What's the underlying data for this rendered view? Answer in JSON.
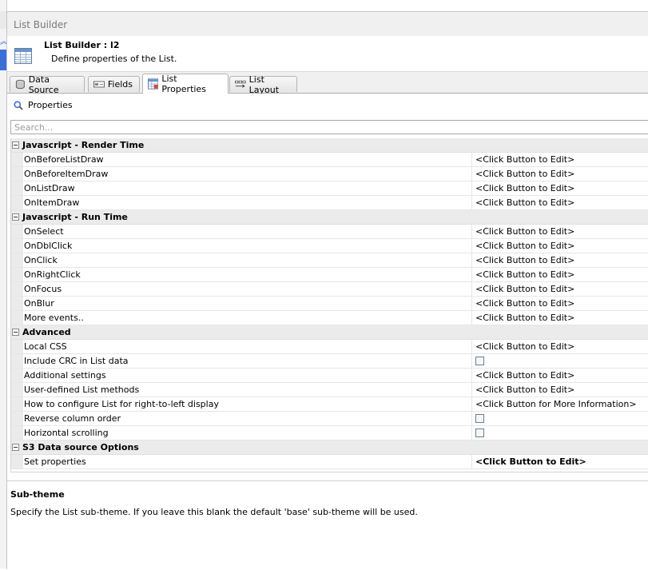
{
  "window": {
    "title": "List Builder"
  },
  "header": {
    "title": "List Builder : l2",
    "subtitle": "Define properties of the List."
  },
  "tabs": [
    {
      "label": "Data Source",
      "icon": "database-icon",
      "active": false
    },
    {
      "label": "Fields",
      "icon": "fields-icon",
      "active": false
    },
    {
      "label": "List Properties",
      "icon": "list-properties-icon",
      "active": true
    },
    {
      "label": "List Layout",
      "icon": "list-layout-icon",
      "active": false
    }
  ],
  "properties": {
    "heading": "Properties",
    "search_placeholder": "Search...",
    "categories": [
      {
        "name": "Javascript - Render Time",
        "items": [
          {
            "name": "OnBeforeListDraw",
            "value": "<Click Button to Edit>"
          },
          {
            "name": "OnBeforeItemDraw",
            "value": "<Click Button to Edit>"
          },
          {
            "name": "OnListDraw",
            "value": "<Click Button to Edit>"
          },
          {
            "name": "OnItemDraw",
            "value": "<Click Button to Edit>"
          }
        ]
      },
      {
        "name": "Javascript - Run Time",
        "items": [
          {
            "name": "OnSelect",
            "value": "<Click Button to Edit>"
          },
          {
            "name": "OnDblClick",
            "value": "<Click Button to Edit>"
          },
          {
            "name": "OnClick",
            "value": "<Click Button to Edit>"
          },
          {
            "name": "OnRightClick",
            "value": "<Click Button to Edit>"
          },
          {
            "name": "OnFocus",
            "value": "<Click Button to Edit>"
          },
          {
            "name": "OnBlur",
            "value": "<Click Button to Edit>"
          },
          {
            "name": "More events..",
            "value": "<Click Button to Edit>"
          }
        ]
      },
      {
        "name": "Advanced",
        "items": [
          {
            "name": "Local CSS",
            "value": "<Click Button to Edit>"
          },
          {
            "name": "Include CRC in List data",
            "value": "",
            "checkbox": true,
            "checked": false
          },
          {
            "name": "Additional settings",
            "value": "<Click Button to Edit>"
          },
          {
            "name": "User-defined List methods",
            "value": "<Click Button to Edit>"
          },
          {
            "name": "How to configure List for right-to-left display",
            "value": "<Click Button for More Information>"
          },
          {
            "name": "Reverse column order",
            "value": "",
            "checkbox": true,
            "checked": false
          },
          {
            "name": "Horizontal scrolling",
            "value": "",
            "checkbox": true,
            "checked": false
          }
        ]
      },
      {
        "name": "S3 Data source Options",
        "items": [
          {
            "name": "Set properties",
            "value": "<Click Button to Edit>",
            "bold": true
          }
        ]
      }
    ]
  },
  "description": {
    "title": "Sub-theme",
    "text": "Specify the List sub-theme. If you leave this blank the default 'base' sub-theme will be used."
  },
  "colors": {
    "accent": "#3b6fd8",
    "category_bg": "#ebebeb"
  }
}
